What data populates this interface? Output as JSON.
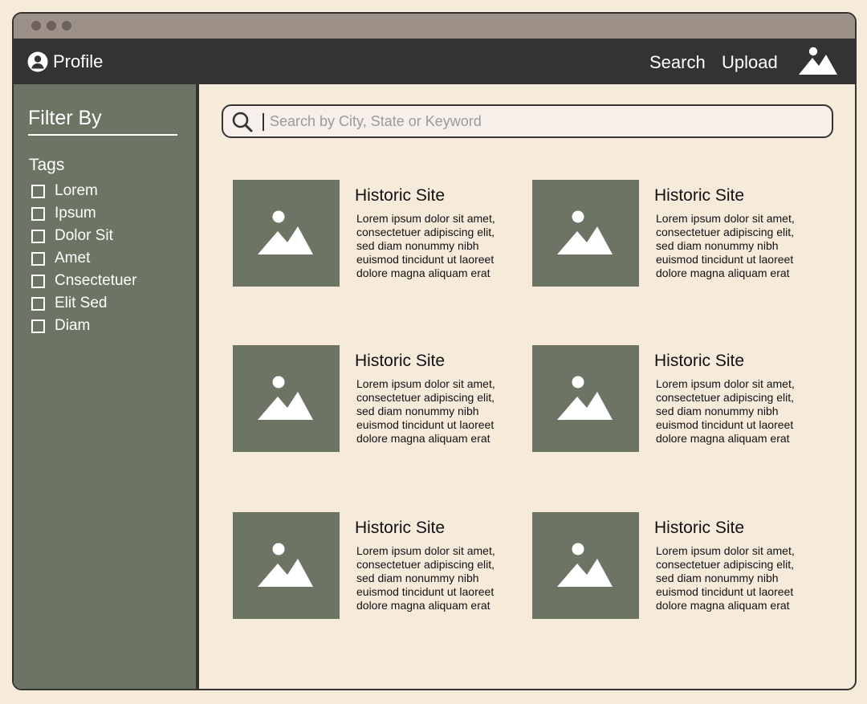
{
  "colors": {
    "background": "#f6eadb",
    "titlebar": "#9c9087",
    "navbar": "#333333",
    "sidebar": "#6c7463",
    "thumbnail": "#6c7463"
  },
  "window": {
    "controls": [
      "window-dot-1",
      "window-dot-2",
      "window-dot-3"
    ]
  },
  "nav": {
    "profile_icon": "user-circle-icon",
    "profile_label": "Profile",
    "search_label": "Search",
    "upload_label": "Upload",
    "logo_icon": "mountain-logo-icon"
  },
  "sidebar": {
    "title": "Filter By",
    "tags_title": "Tags",
    "tags": [
      {
        "label": "Lorem",
        "checked": false
      },
      {
        "label": "Ipsum",
        "checked": false
      },
      {
        "label": "Dolor Sit",
        "checked": false
      },
      {
        "label": "Amet",
        "checked": false
      },
      {
        "label": "Cnsectetuer",
        "checked": false
      },
      {
        "label": "Elit Sed",
        "checked": false
      },
      {
        "label": "Diam",
        "checked": false
      }
    ]
  },
  "search": {
    "icon": "search-icon",
    "placeholder": "Search by City, State or Keyword",
    "value": ""
  },
  "cards": [
    {
      "title": "Historic Site",
      "image_icon": "image-placeholder-icon",
      "description": [
        "Lorem ipsum dolor sit amet,",
        "consectetuer adipiscing elit,",
        "sed diam nonummy nibh",
        "euismod tincidunt ut laoreet",
        "dolore magna aliquam erat"
      ]
    },
    {
      "title": "Historic Site",
      "image_icon": "image-placeholder-icon",
      "description": [
        "Lorem ipsum dolor sit amet,",
        "consectetuer adipiscing elit,",
        "sed diam nonummy nibh",
        "euismod tincidunt ut laoreet",
        "dolore magna aliquam erat"
      ]
    },
    {
      "title": "Historic Site",
      "image_icon": "image-placeholder-icon",
      "description": [
        "Lorem ipsum dolor sit amet,",
        "consectetuer adipiscing elit,",
        "sed diam nonummy nibh",
        "euismod tincidunt ut laoreet",
        "dolore magna aliquam erat"
      ]
    },
    {
      "title": "Historic Site",
      "image_icon": "image-placeholder-icon",
      "description": [
        "Lorem ipsum dolor sit amet,",
        "consectetuer adipiscing elit,",
        "sed diam nonummy nibh",
        "euismod tincidunt ut laoreet",
        "dolore magna aliquam erat"
      ]
    },
    {
      "title": "Historic Site",
      "image_icon": "image-placeholder-icon",
      "description": [
        "Lorem ipsum dolor sit amet,",
        "consectetuer adipiscing elit,",
        "sed diam nonummy nibh",
        "euismod tincidunt ut laoreet",
        "dolore magna aliquam erat"
      ]
    },
    {
      "title": "Historic Site",
      "image_icon": "image-placeholder-icon",
      "description": [
        "Lorem ipsum dolor sit amet,",
        "consectetuer adipiscing elit,",
        "sed diam nonummy nibh",
        "euismod tincidunt ut laoreet",
        "dolore magna aliquam erat"
      ]
    }
  ]
}
